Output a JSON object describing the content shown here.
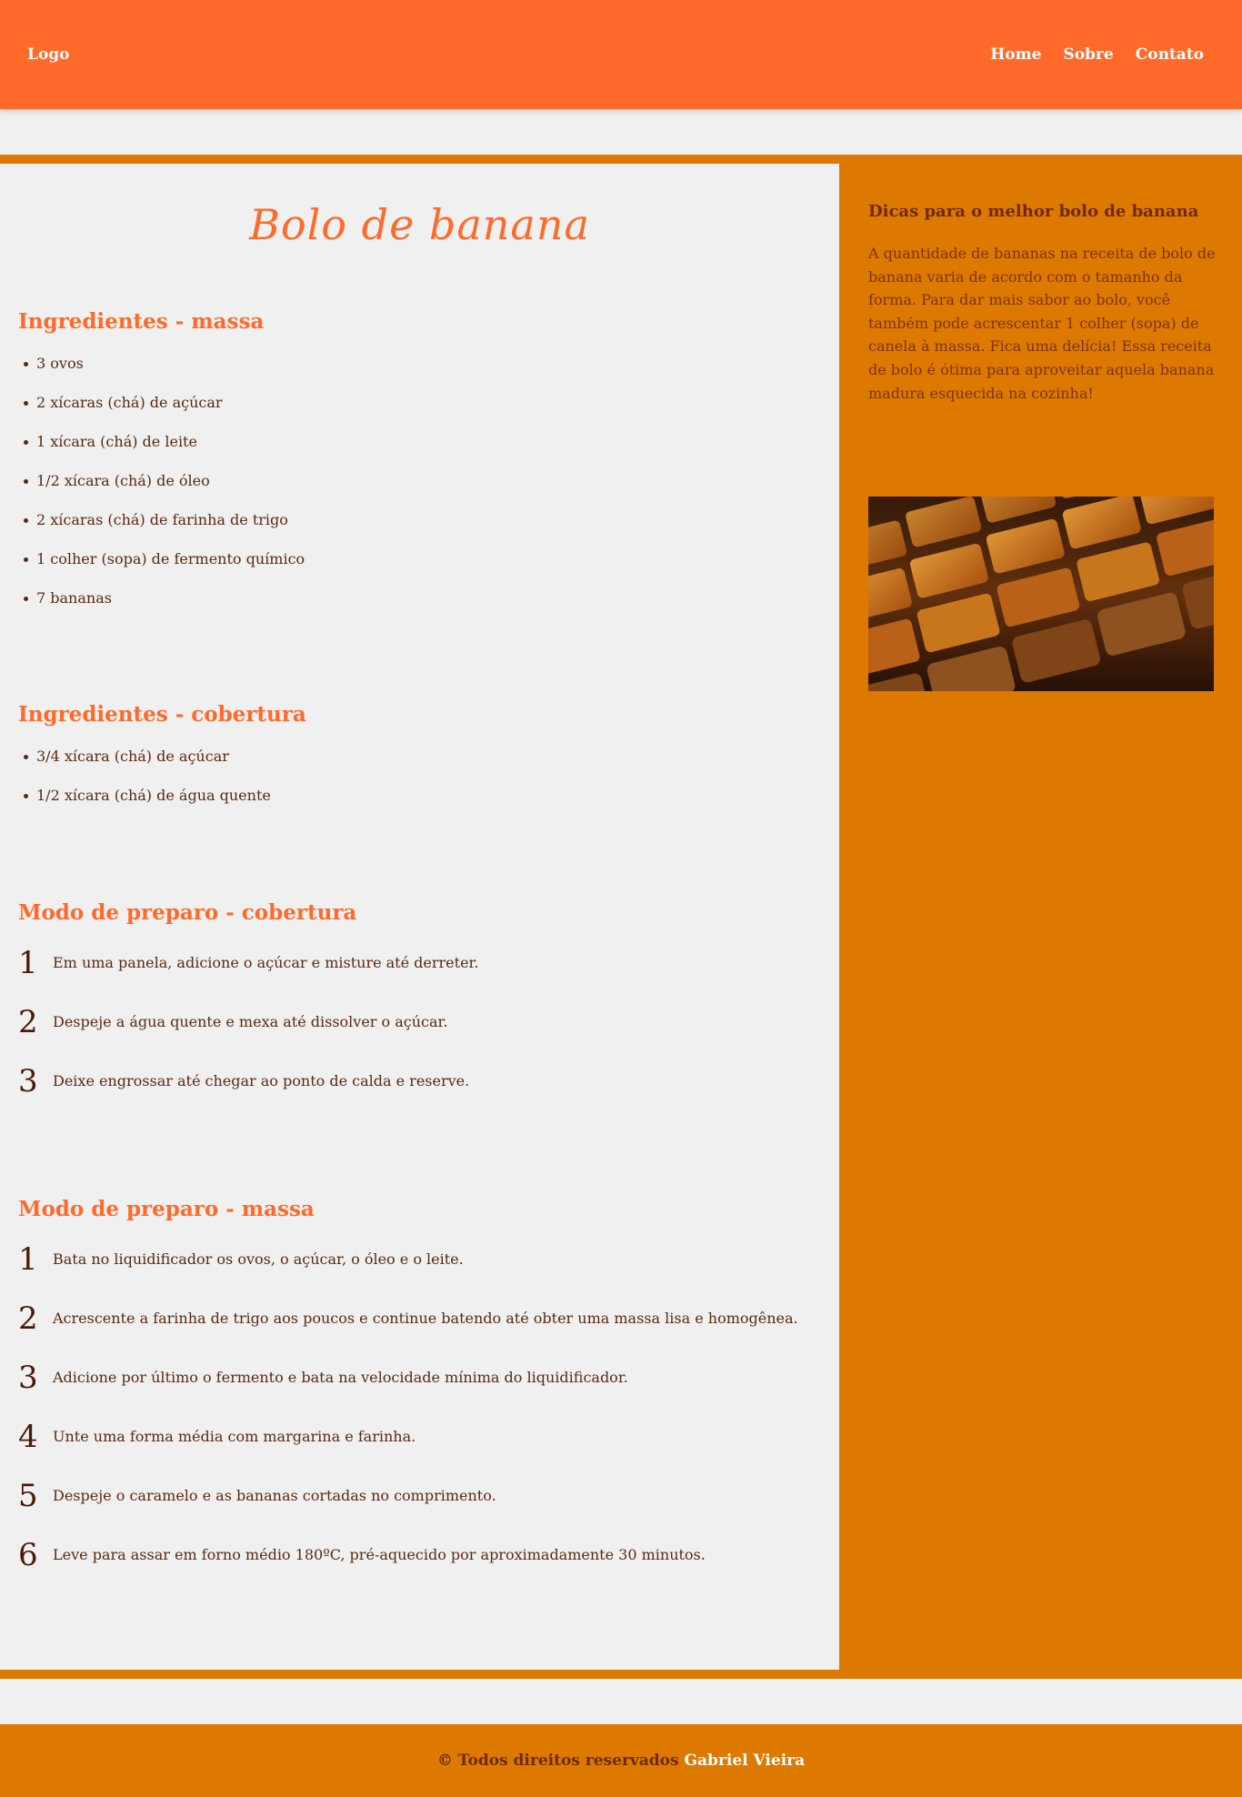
{
  "header": {
    "logo": "Logo",
    "nav": [
      "Home",
      "Sobre",
      "Contato"
    ]
  },
  "main": {
    "title": "Bolo de banana",
    "ingredientes_massa": {
      "heading": "Ingredientes - massa",
      "items": [
        "3 ovos",
        "2 xícaras (chá) de açúcar",
        "1 xícara (chá) de leite",
        "1/2 xícara (chá) de óleo",
        "2 xícaras (chá) de farinha de trigo",
        "1 colher (sopa) de fermento químico",
        "7 bananas"
      ]
    },
    "ingredientes_cobertura": {
      "heading": "Ingredientes - cobertura",
      "items": [
        "3/4 xícara (chá) de açúcar",
        "1/2 xícara (chá) de água quente"
      ]
    },
    "preparo_cobertura": {
      "heading": "Modo de preparo - cobertura",
      "steps": [
        {
          "n": "1",
          "text": "Em uma panela, adicione o açúcar e misture até derreter."
        },
        {
          "n": "2",
          "text": "Despeje a água quente e mexa até dissolver o açúcar."
        },
        {
          "n": "3",
          "text": "Deixe engrossar até chegar ao ponto de calda e reserve."
        }
      ]
    },
    "preparo_massa": {
      "heading": "Modo de preparo - massa",
      "steps": [
        {
          "n": "1",
          "text": "Bata no liquidificador os ovos, o açúcar, o óleo e o leite."
        },
        {
          "n": "2",
          "text": "Acrescente a farinha de trigo aos poucos e continue batendo até obter uma massa lisa e homogênea."
        },
        {
          "n": "3",
          "text": "Adicione por último o fermento e bata na velocidade mínima do liquidificador."
        },
        {
          "n": "4",
          "text": "Unte uma forma média com margarina e farinha."
        },
        {
          "n": "5",
          "text": "Despeje o caramelo e as bananas cortadas no comprimento."
        },
        {
          "n": "6",
          "text": "Leve para assar em forno médio 180ºC, pré-aquecido por aproximadamente 30 minutos."
        }
      ]
    }
  },
  "aside": {
    "title": "Dicas para o melhor bolo de banana",
    "text": "A quantidade de bananas na receita de bolo de banana varia de acordo com o tamanho da forma. Para dar mais sabor ao bolo, você também pode acrescentar 1 colher (sopa) de canela à massa. Fica uma delícia! Essa receita de bolo é ótima para aproveitar aquela banana madura esquecida na cozinha!"
  },
  "footer": {
    "text": "© Todos direitos reservados",
    "author": "Gabriel Vieira"
  },
  "colors": {
    "header": "#ff6a2b",
    "accent": "#dd7800",
    "heading": "#ff6a2b",
    "body_text": "#5a2a10"
  }
}
